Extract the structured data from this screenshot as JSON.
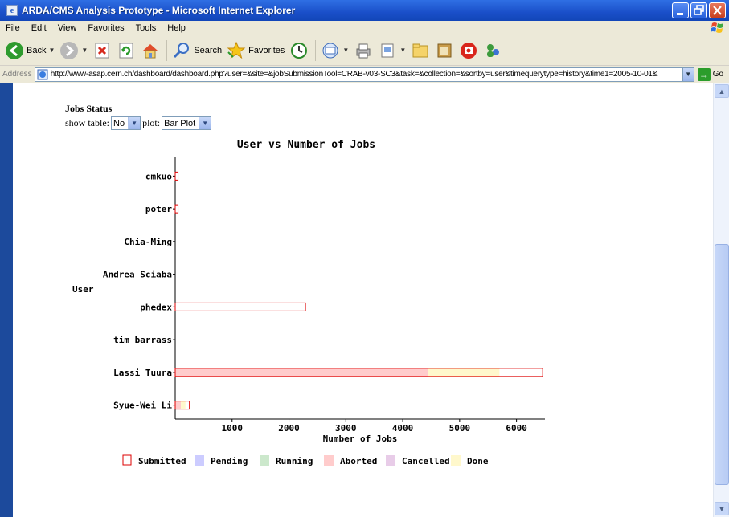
{
  "window": {
    "title": "ARDA/CMS Analysis Prototype - Microsoft Internet Explorer"
  },
  "menu": [
    "File",
    "Edit",
    "View",
    "Favorites",
    "Tools",
    "Help"
  ],
  "toolbar": {
    "back_label": "Back",
    "search_label": "Search",
    "favorites_label": "Favorites"
  },
  "address": {
    "label": "Address",
    "url": "http://www-asap.cern.ch/dashboard/dashboard.php?user=&site=&jobSubmissionTool=CRAB-v03-SC3&task=&collection=&sortby=user&timequerytype=history&time1=2005-10-01&",
    "go_label": "Go"
  },
  "page": {
    "heading": "Jobs Status",
    "show_table_label": "show table:",
    "show_table_value": "No",
    "plot_label": "plot:",
    "plot_value": "Bar Plot"
  },
  "chart_data": {
    "type": "bar",
    "orientation": "horizontal",
    "stacked": true,
    "title": "User vs Number of Jobs",
    "xlabel": "Number of Jobs",
    "ylabel": "User",
    "xlim": [
      0,
      6500
    ],
    "xticks": [
      1000,
      2000,
      3000,
      4000,
      5000,
      6000
    ],
    "grid": false,
    "legend_position": "bottom",
    "categories": [
      "cmkuo",
      "poter",
      "Chia-Ming",
      "Andrea Sciaba",
      "phedex",
      "tim barrass",
      "Lassi Tuura",
      "Syue-Wei Li"
    ],
    "series": [
      {
        "name": "Pending",
        "color": "#ccccff",
        "values": [
          0,
          0,
          0,
          0,
          0,
          0,
          0,
          0
        ]
      },
      {
        "name": "Running",
        "color": "#cce8cc",
        "values": [
          0,
          0,
          0,
          0,
          0,
          0,
          0,
          0
        ]
      },
      {
        "name": "Aborted",
        "color": "#ffcccc",
        "values": [
          0,
          0,
          0,
          0,
          0,
          0,
          4450,
          100
        ]
      },
      {
        "name": "Cancelled",
        "color": "#e8cce8",
        "values": [
          0,
          0,
          0,
          0,
          0,
          0,
          0,
          0
        ]
      },
      {
        "name": "Done",
        "color": "#fff8cc",
        "values": [
          0,
          0,
          0,
          0,
          0,
          0,
          1250,
          80
        ]
      }
    ],
    "submitted": {
      "name": "Submitted",
      "color": "#dd0000",
      "values": [
        50,
        50,
        0,
        0,
        2290,
        0,
        6460,
        250
      ]
    }
  }
}
